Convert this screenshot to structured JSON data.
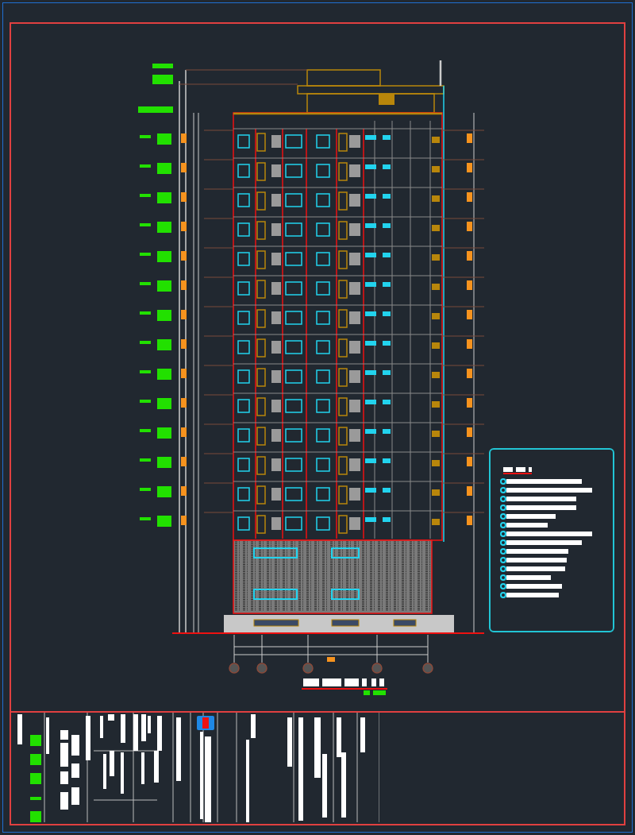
{
  "elevation": {
    "floors": [
      {
        "kind": "typical"
      },
      {
        "kind": "typical"
      },
      {
        "kind": "typical"
      },
      {
        "kind": "typical"
      },
      {
        "kind": "typical"
      },
      {
        "kind": "typical"
      },
      {
        "kind": "typical"
      },
      {
        "kind": "typical"
      },
      {
        "kind": "typical"
      },
      {
        "kind": "typical"
      },
      {
        "kind": "typical"
      },
      {
        "kind": "typical"
      },
      {
        "kind": "typical"
      },
      {
        "kind": "typical"
      },
      {
        "kind": "podium"
      },
      {
        "kind": "base"
      }
    ]
  },
  "legend": {
    "entries": [
      {
        "kind": "note"
      },
      {
        "kind": "note"
      },
      {
        "kind": "note"
      },
      {
        "kind": "note"
      },
      {
        "kind": "note"
      },
      {
        "kind": "note"
      },
      {
        "kind": "note"
      },
      {
        "kind": "note"
      },
      {
        "kind": "note"
      },
      {
        "kind": "note"
      },
      {
        "kind": "note"
      },
      {
        "kind": "note"
      },
      {
        "kind": "note"
      },
      {
        "kind": "note"
      }
    ]
  }
}
